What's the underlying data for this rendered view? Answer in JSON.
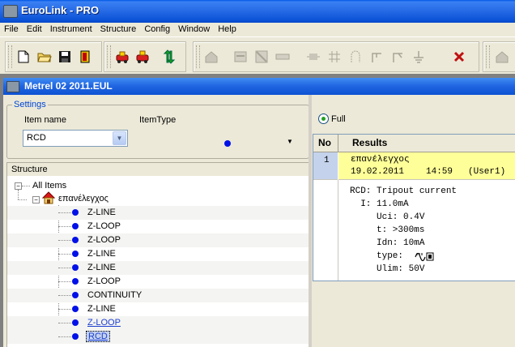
{
  "app": {
    "title": "EuroLink - PRO"
  },
  "menu": [
    "File",
    "Edit",
    "Instrument",
    "Structure",
    "Config",
    "Window",
    "Help"
  ],
  "toolbar": {
    "group1": [
      "new-icon",
      "open-icon",
      "save-icon",
      "exit-icon"
    ],
    "group2": [
      "download-icon",
      "upload-icon",
      "sync-icon"
    ],
    "group3": [
      "object-icon",
      "box-icon",
      "fuse-icon",
      "connection-icon",
      "element-icon",
      "grid-icon",
      "cable-icon",
      "branch-icon",
      "switch-icon",
      "ground-icon",
      "delete-icon"
    ]
  },
  "child": {
    "title": "Metrel 02 2011.EUL"
  },
  "settings": {
    "legend": "Settings",
    "item_name_label": "Item name",
    "item_type_label": "ItemType",
    "item_name_value": "RCD"
  },
  "structure": {
    "header": "Structure",
    "root": "All Items",
    "object": "επανέλεγχος",
    "items": [
      "Z-LINE",
      "Z-LOOP",
      "Z-LOOP",
      "Z-LINE",
      "Z-LINE",
      "Z-LOOP",
      "CONTINUITY",
      "Z-LINE",
      "Z-LOOP",
      "RCD"
    ]
  },
  "results": {
    "radio_label": "Full",
    "col_no": "No",
    "col_results": "Results",
    "row_no": "1",
    "object_name": "επανέλεγχος",
    "date": "19.02.2011",
    "time": "14:59",
    "user": "(User1)",
    "test_title": "RCD: Tripout current",
    "lines": [
      "  I: 11.0mA",
      "     Uci: 0.4V",
      "     t: >300ms",
      "     Idn: 10mA",
      "     type:",
      "     Ulim: 50V"
    ]
  },
  "colors": {
    "title_blue": "#0a52d6",
    "selected_row": "#ffff99",
    "dot_blue": "#0010e8"
  }
}
